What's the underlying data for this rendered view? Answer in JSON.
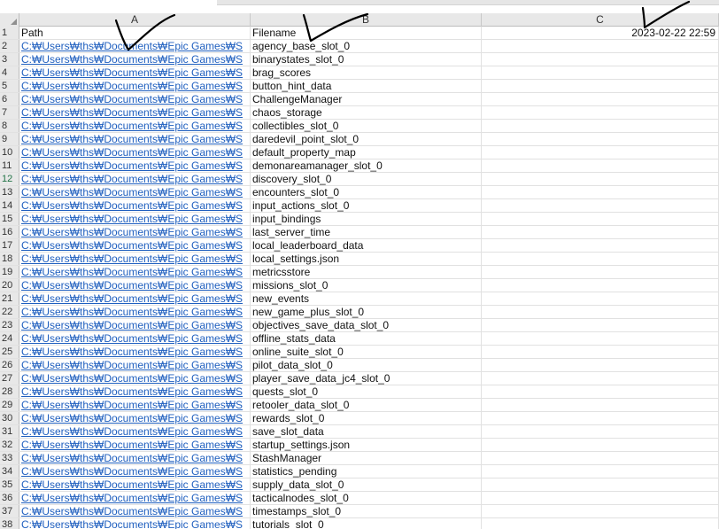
{
  "columns": [
    "A",
    "B",
    "C"
  ],
  "header_row": {
    "num": "1",
    "path": "Path",
    "filename": "Filename",
    "datetime": "2023-02-22 22:59"
  },
  "path_value": "C:₩Users₩ths₩Documents₩Epic Games₩S",
  "rows": [
    {
      "num": "2",
      "filename": "agency_base_slot_0"
    },
    {
      "num": "3",
      "filename": "binarystates_slot_0"
    },
    {
      "num": "4",
      "filename": "brag_scores"
    },
    {
      "num": "5",
      "filename": "button_hint_data"
    },
    {
      "num": "6",
      "filename": "ChallengeManager"
    },
    {
      "num": "7",
      "filename": "chaos_storage"
    },
    {
      "num": "8",
      "filename": "collectibles_slot_0"
    },
    {
      "num": "9",
      "filename": "daredevil_point_slot_0"
    },
    {
      "num": "10",
      "filename": "default_property_map"
    },
    {
      "num": "11",
      "filename": "demonareamanager_slot_0"
    },
    {
      "num": "12",
      "filename": "discovery_slot_0"
    },
    {
      "num": "13",
      "filename": "encounters_slot_0"
    },
    {
      "num": "14",
      "filename": "input_actions_slot_0"
    },
    {
      "num": "15",
      "filename": "input_bindings"
    },
    {
      "num": "16",
      "filename": "last_server_time"
    },
    {
      "num": "17",
      "filename": "local_leaderboard_data"
    },
    {
      "num": "18",
      "filename": "local_settings.json"
    },
    {
      "num": "19",
      "filename": "metricsstore"
    },
    {
      "num": "20",
      "filename": "missions_slot_0"
    },
    {
      "num": "21",
      "filename": "new_events"
    },
    {
      "num": "22",
      "filename": "new_game_plus_slot_0"
    },
    {
      "num": "23",
      "filename": "objectives_save_data_slot_0"
    },
    {
      "num": "24",
      "filename": "offline_stats_data"
    },
    {
      "num": "25",
      "filename": "online_suite_slot_0"
    },
    {
      "num": "26",
      "filename": "pilot_data_slot_0"
    },
    {
      "num": "27",
      "filename": "player_save_data_jc4_slot_0"
    },
    {
      "num": "28",
      "filename": "quests_slot_0"
    },
    {
      "num": "29",
      "filename": "retooler_data_slot_0"
    },
    {
      "num": "30",
      "filename": "rewards_slot_0"
    },
    {
      "num": "31",
      "filename": "save_slot_data"
    },
    {
      "num": "32",
      "filename": "startup_settings.json"
    },
    {
      "num": "33",
      "filename": "StashManager"
    },
    {
      "num": "34",
      "filename": "statistics_pending"
    },
    {
      "num": "35",
      "filename": "supply_data_slot_0"
    },
    {
      "num": "36",
      "filename": "tacticalnodes_slot_0"
    },
    {
      "num": "37",
      "filename": "timestamps_slot_0"
    },
    {
      "num": "38",
      "filename": "tutorials_slot_0"
    }
  ],
  "selected_row": "12",
  "colors": {
    "link": "#1f5fbf",
    "header_bg": "#e8e8e8",
    "selected_row_num": "#217346",
    "annotation_ink": "#000000"
  }
}
